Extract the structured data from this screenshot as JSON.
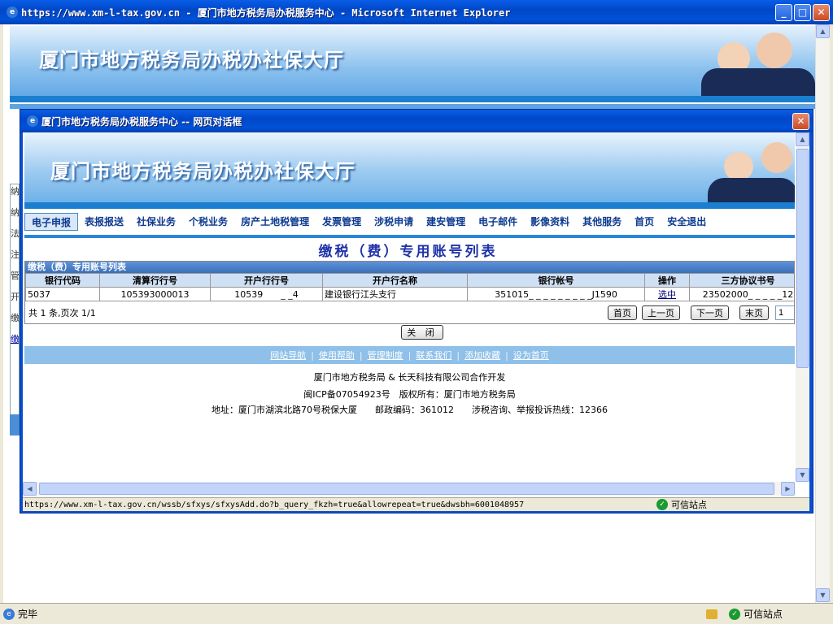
{
  "browser": {
    "title": "https://www.xm-l-tax.gov.cn - 厦门市地方税务局办税服务中心 - Microsoft Internet Explorer",
    "status": "完毕",
    "zone": "可信站点"
  },
  "outer": {
    "banner_title": "厦门市地方税务局办税办社保大厅",
    "left_labels": [
      "纳",
      "纳",
      "法",
      "注",
      "管",
      "开",
      "缴",
      "缴"
    ]
  },
  "dialog": {
    "title": "厦门市地方税务局办税服务中心 -- 网页对话框",
    "banner_title": "厦门市地方税务局办税办社保大厅",
    "status_url": "https://www.xm-l-tax.gov.cn/wssb/sfxys/sfxysAdd.do?b_query_fkzh=true&allowrepeat=true&dwsbh=6001048957",
    "zone": "可信站点"
  },
  "nav": [
    "电子申报",
    "表报报送",
    "社保业务",
    "个税业务",
    "房产土地税管理",
    "发票管理",
    "涉税申请",
    "建安管理",
    "电子邮件",
    "影像资料",
    "其他服务",
    "首页",
    "安全退出"
  ],
  "list": {
    "title": "缴税（费）专用账号列表",
    "panel_header": "缴税（费）专用账号列表",
    "columns": [
      "银行代码",
      "清算行行号",
      "开户行行号",
      "开户行名称",
      "银行帐号",
      "操作",
      "三方协议书号"
    ],
    "rows": [
      [
        "5037",
        "105393000013",
        "10539　　_ _4",
        "建设银行江头支行",
        "351015_ _ _ _ _ _ _ _ _J1590",
        "选中",
        "23502000_ _ _ _ _12"
      ]
    ],
    "pager_info": "共 1 条,页次 1/1",
    "first": "首页",
    "prev": "上一页",
    "next": "下一页",
    "last": "末页",
    "page_value": "1"
  },
  "close_label": "关 闭",
  "footer": {
    "links": [
      "网站导航",
      "使用帮助",
      "管理制度",
      "联系我们",
      "添加收藏",
      "设为首页"
    ],
    "line1": "厦门市地方税务局 & 长天科技有限公司合作开发",
    "line2": "闽ICP备07054923号　版权所有：厦门市地方税务局",
    "line3": "地址：厦门市湖滨北路70号税保大厦　　邮政编码：361012　　涉税咨询、举报投诉热线：12366"
  }
}
